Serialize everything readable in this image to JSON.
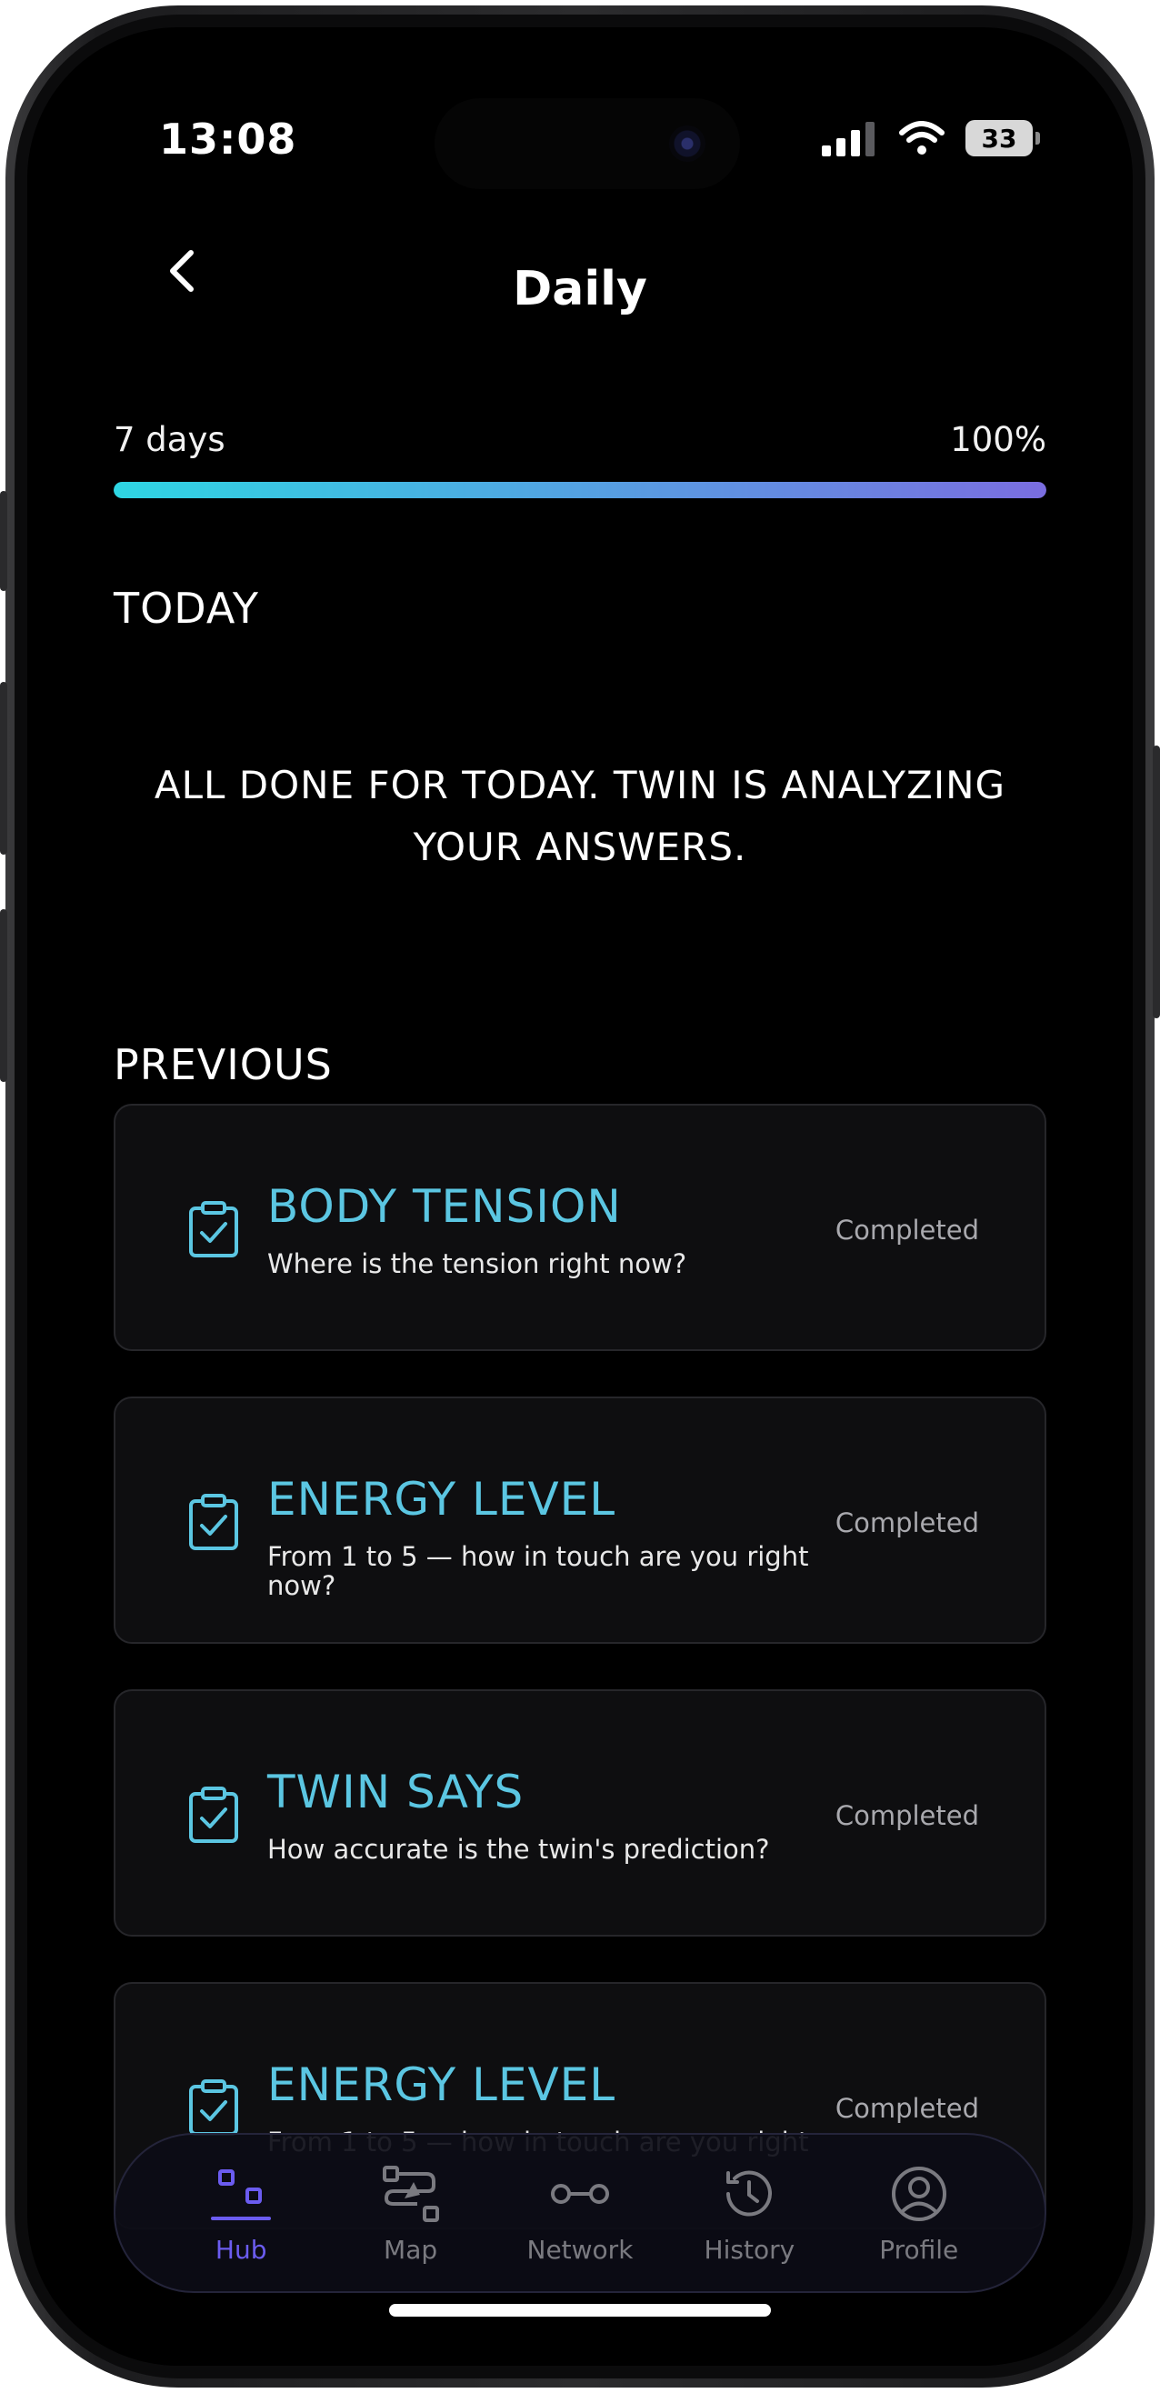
{
  "status_bar": {
    "time": "13:08",
    "battery": "33"
  },
  "header": {
    "title": "Daily"
  },
  "progress": {
    "label": "7 days",
    "percent_text": "100%",
    "value": 1.0
  },
  "today": {
    "heading": "TODAY",
    "message_line1": "ALL DONE FOR TODAY. TWIN IS ANALYZING",
    "message_line2": "YOUR ANSWERS."
  },
  "previous": {
    "heading": "PREVIOUS",
    "items": [
      {
        "title": "BODY TENSION",
        "subtitle": "Where is the tension right now?",
        "status": "Completed"
      },
      {
        "title": "ENERGY LEVEL",
        "subtitle": "From 1 to 5 — how in touch are you right now?",
        "status": "Completed"
      },
      {
        "title": "TWIN SAYS",
        "subtitle": "How accurate is the twin's prediction?",
        "status": "Completed"
      },
      {
        "title": "ENERGY LEVEL",
        "subtitle": "From 1 to 5 — how in touch are you right",
        "status": "Completed"
      }
    ]
  },
  "tabbar": {
    "items": [
      {
        "label": "Hub",
        "icon": "hub-icon",
        "active": true
      },
      {
        "label": "Map",
        "icon": "map-icon",
        "active": false
      },
      {
        "label": "Network",
        "icon": "network-icon",
        "active": false
      },
      {
        "label": "History",
        "icon": "history-icon",
        "active": false
      },
      {
        "label": "Profile",
        "icon": "profile-icon",
        "active": false
      }
    ]
  },
  "colors": {
    "accent": "#5bc6e2",
    "active_tab": "#6b5cf0",
    "progress_start": "#2ed6e3",
    "progress_end": "#7a6de0"
  }
}
